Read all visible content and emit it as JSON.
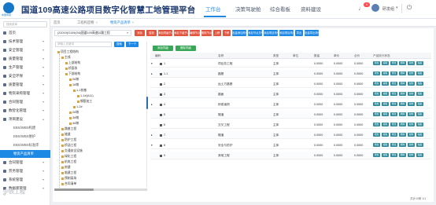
{
  "header": {
    "logo_text": "中国中铁",
    "title": "国道109高速公路项目数字化智慧工地管理平台",
    "nav": [
      "企业门户",
      "工作台",
      "决策驾驶舱",
      "综合看板",
      "资料建设"
    ],
    "active_nav": "工作台",
    "notification_count": "9",
    "username": "研发组"
  },
  "sidebar": {
    "search_placeholder": "搜索菜单",
    "items": [
      {
        "label": "首页"
      },
      {
        "label": "技术管理"
      },
      {
        "label": "安全管理"
      },
      {
        "label": "质量管理"
      },
      {
        "label": "生产管理"
      },
      {
        "label": "安全环保"
      },
      {
        "label": "质量管理"
      },
      {
        "label": "物资采购管理"
      },
      {
        "label": "合同管理"
      },
      {
        "label": "数智化管理"
      },
      {
        "label": "项目建设"
      }
    ],
    "sub_items": [
      "EBS/WBS构建",
      "EBS/WBS维护",
      "EBS/WBS标准库",
      "物资产品清单"
    ],
    "active_sub": "物资产品清单",
    "items_after": [
      {
        "label": "合同管理"
      },
      {
        "label": "劳务管理"
      },
      {
        "label": "系统管理"
      },
      {
        "label": "数据库管理"
      }
    ],
    "collapse_glyph": "«"
  },
  "tabs": [
    {
      "label": "首页"
    },
    {
      "label": "工程构造物"
    },
    {
      "label": "物资产品清单"
    }
  ],
  "toolbar": {
    "project": "(22019)G109(G6)国道109高速公路工程",
    "buttons": [
      {
        "label": "添加",
        "color": "#e2553f"
      },
      {
        "label": "复制",
        "color": "#e2553f"
      },
      {
        "label": "添加同级节点",
        "color": "#e2553f"
      },
      {
        "label": "添加下级节点",
        "color": "#e2553f"
      },
      {
        "label": "编辑节点",
        "color": "#e2553f"
      },
      {
        "label": "删除节点",
        "color": "#e2553f"
      },
      {
        "label": "上移",
        "color": "#e2553f"
      },
      {
        "label": "下移",
        "color": "#e2553f"
      },
      {
        "label": "批量添加构件",
        "color": "#1e88e5"
      },
      {
        "label": "添加节点关联",
        "color": "#1e88e5"
      },
      {
        "label": "添加项目构件",
        "color": "#1e88e5"
      },
      {
        "label": "添加项目构件",
        "color": "#1e88e5"
      },
      {
        "label": "导出",
        "color": "#1e88e5"
      },
      {
        "label": "批量导出构件",
        "color": "#1e88e5"
      }
    ]
  },
  "tree": {
    "search_placeholder": "请输入关键词",
    "search_label": "搜索",
    "next_label": "下一个",
    "nodes": [
      {
        "label": "项目工程结构",
        "level": 0
      },
      {
        "label": "主线",
        "level": 1
      },
      {
        "label": "上部结构",
        "level": 2
      },
      {
        "label": "桥面系",
        "level": 2
      },
      {
        "label": "下部结构",
        "level": 2
      },
      {
        "label": "0#墩",
        "level": 3
      },
      {
        "label": "1#墩",
        "level": 3
      },
      {
        "label": "1-1桩基",
        "level": 4
      },
      {
        "label": "1-1#(A11)",
        "level": 5
      },
      {
        "label": "钢筋加工",
        "level": 5
      },
      {
        "label": "1-2#",
        "level": 4
      },
      {
        "label": "2#墩",
        "level": 3
      },
      {
        "label": "3#墩",
        "level": 3
      },
      {
        "label": "4#墩",
        "level": 3
      },
      {
        "label": "路基工程",
        "level": 1
      },
      {
        "label": "隧道",
        "level": 1
      },
      {
        "label": "防护工程",
        "level": 1
      },
      {
        "label": "桥涵工程",
        "level": 1
      },
      {
        "label": "交通安全设施",
        "level": 1
      },
      {
        "label": "绿化工程",
        "level": 1
      },
      {
        "label": "机电工程",
        "level": 1
      },
      {
        "label": "房建",
        "level": 1
      },
      {
        "label": "临建工程",
        "level": 1
      },
      {
        "label": "预制梁场",
        "level": 1
      },
      {
        "label": "合同清单",
        "level": 1
      }
    ]
  },
  "grid": {
    "actions": [
      "添加同级",
      "删除同级"
    ],
    "columns": [
      "编码",
      "名称",
      "类型",
      "单位",
      "数量",
      "单价",
      "合价",
      "产品执行状态"
    ],
    "rows": [
      {
        "code": "1",
        "name": "项目总工程",
        "type": "主体",
        "unit": "",
        "qty": "0.0000",
        "price": "0.0000",
        "total": "0.0000",
        "expand": "▾"
      },
      {
        "code": "1.1",
        "name": "路基",
        "type": "主体",
        "unit": "",
        "qty": "0.0000",
        "price": "0.0000",
        "total": "0.0000",
        "expand": "▸"
      },
      {
        "code": "2",
        "name": "运土方路基",
        "type": "主体",
        "unit": "",
        "qty": "0.0000",
        "price": "0.0000",
        "total": "0.0000",
        "expand": ""
      },
      {
        "code": "3",
        "name": "路面",
        "type": "主体",
        "unit": "",
        "qty": "0.0000",
        "price": "0.0000",
        "total": "0.0000",
        "expand": ""
      },
      {
        "code": "4",
        "name": "桥梁涵洞",
        "type": "主体",
        "unit": "",
        "qty": "0.0000",
        "price": "0.0000",
        "total": "0.0000",
        "expand": "▸"
      },
      {
        "code": "5",
        "name": "隧道",
        "type": "主体",
        "unit": "",
        "qty": "0.0000",
        "price": "0.0000",
        "total": "0.0000",
        "expand": ""
      },
      {
        "code": "6",
        "name": "交叉工程",
        "type": "主体",
        "unit": "",
        "qty": "0.0000",
        "price": "0.0000",
        "total": "0.0000",
        "expand": ""
      },
      {
        "code": "7",
        "name": "隧道",
        "type": "主体",
        "unit": "",
        "qty": "0.0000",
        "price": "0.0000",
        "total": "0.0000",
        "expand": "▸"
      },
      {
        "code": "8",
        "name": "安全与防护",
        "type": "主体",
        "unit": "",
        "qty": "0.0000",
        "price": "0.0000",
        "total": "0.0000",
        "expand": "▾"
      },
      {
        "code": "9",
        "name": "其他工程",
        "type": "主体",
        "unit": "",
        "qty": "0.0000",
        "price": "0.0000",
        "total": "0.0000",
        "expand": ""
      }
    ],
    "row_buttons": [
      "增加",
      "编辑",
      "修改",
      "删除",
      "复制",
      "粘贴"
    ]
  },
  "footer": {
    "watermark": "中铁工程",
    "pager": "共计10条 1/1"
  }
}
